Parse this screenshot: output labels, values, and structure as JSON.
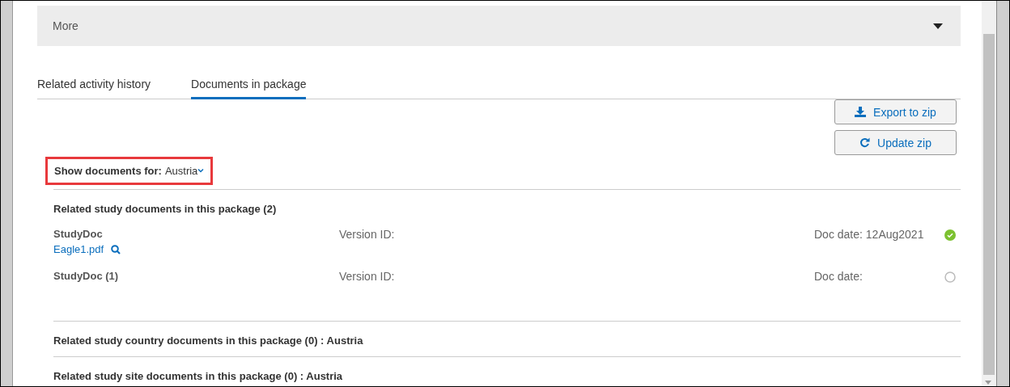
{
  "accordion": {
    "title": "More",
    "expanded": false
  },
  "tabs": [
    {
      "label": "Related activity history",
      "selected": false
    },
    {
      "label": "Documents in package",
      "selected": true
    }
  ],
  "actions": [
    {
      "kind": "export",
      "label": "Export to zip"
    },
    {
      "kind": "update",
      "label": "Update zip"
    }
  ],
  "filter": {
    "label": "Show documents for:",
    "value": "Austria"
  },
  "sections": [
    {
      "title": "Related study documents in this package (2)",
      "documents": [
        {
          "name": "StudyDoc",
          "file": "Eagle1.pdf",
          "version": "Version ID:",
          "doc_date": "Doc date: 12Aug2021",
          "checked": true
        },
        {
          "name": "StudyDoc (1)",
          "version": "Version ID:",
          "doc_date": "Doc date:",
          "checked": false
        }
      ]
    },
    {
      "title": "Related study country documents in this package (0) : Austria"
    },
    {
      "title": "Related study site documents in this package (0) : Austria"
    }
  ]
}
